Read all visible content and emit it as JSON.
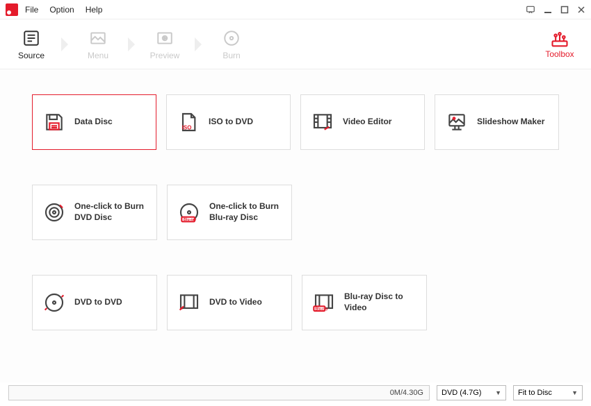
{
  "menubar": {
    "file": "File",
    "option": "Option",
    "help": "Help"
  },
  "steps": {
    "source": "Source",
    "menu": "Menu",
    "preview": "Preview",
    "burn": "Burn"
  },
  "toolbox": "Toolbox",
  "cards": {
    "data_disc": "Data Disc",
    "iso_to_dvd": "ISO to DVD",
    "video_editor": "Video Editor",
    "slideshow_maker": "Slideshow Maker",
    "one_click_dvd": "One-click to Burn DVD Disc",
    "one_click_bluray": "One-click to Burn Blu-ray Disc",
    "dvd_to_dvd": "DVD to DVD",
    "dvd_to_video": "DVD to Video",
    "bluray_to_video": "Blu-ray Disc to Video"
  },
  "status": {
    "progress_text": "0M/4.30G",
    "disc_select": "DVD (4.7G)",
    "fit_select": "Fit to Disc"
  }
}
